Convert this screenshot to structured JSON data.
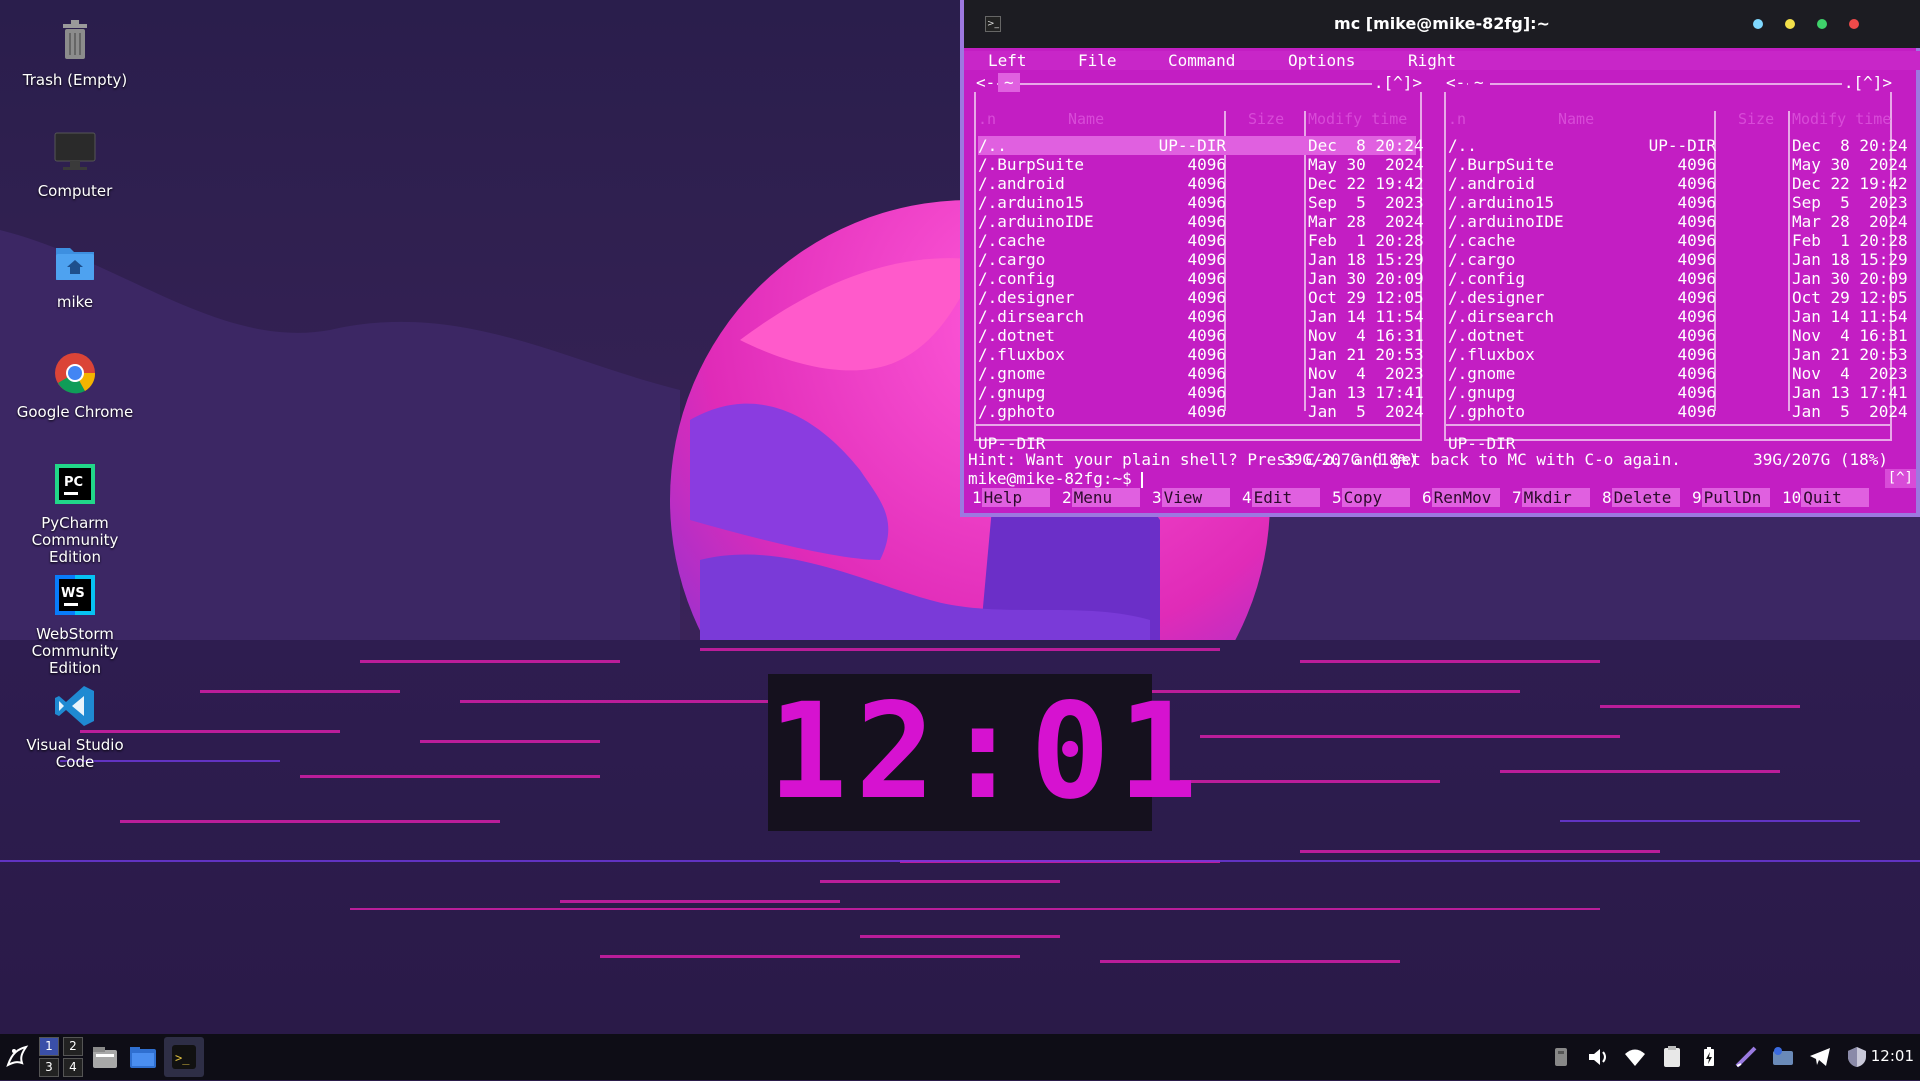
{
  "desktop": {
    "icons": [
      {
        "label": "Trash (Empty)"
      },
      {
        "label": "Computer"
      },
      {
        "label": "mike"
      },
      {
        "label": "Google Chrome"
      },
      {
        "label": "PyCharm Community Edition",
        "badge": "PC"
      },
      {
        "label": "WebStorm Community Edition",
        "badge": "WS"
      },
      {
        "label": "Visual Studio Code"
      }
    ],
    "clock": "12:01"
  },
  "window": {
    "title": "mc [mike@mike-82fg]:~",
    "menu": [
      "Left",
      "File",
      "Command",
      "Options",
      "Right"
    ],
    "left_panel": {
      "path": "~",
      "header_right": ".[^]>",
      "header_left": "<-"
    },
    "right_panel": {
      "path": "~",
      "header_right": ".[^]>",
      "header_left": "<-"
    },
    "columns": {
      "name": "Name",
      "size": "Size",
      "modify": "Modify time",
      "sort": ".n"
    },
    "rows": [
      {
        "name": "/..",
        "size": "UP--DIR",
        "time": "Dec  8 20:24"
      },
      {
        "name": "/.BurpSuite",
        "size": "4096",
        "time": "May 30  2024"
      },
      {
        "name": "/.android",
        "size": "4096",
        "time": "Dec 22 19:42"
      },
      {
        "name": "/.arduino15",
        "size": "4096",
        "time": "Sep  5  2023"
      },
      {
        "name": "/.arduinoIDE",
        "size": "4096",
        "time": "Mar 28  2024"
      },
      {
        "name": "/.cache",
        "size": "4096",
        "time": "Feb  1 20:28"
      },
      {
        "name": "/.cargo",
        "size": "4096",
        "time": "Jan 18 15:29"
      },
      {
        "name": "/.config",
        "size": "4096",
        "time": "Jan 30 20:09"
      },
      {
        "name": "/.designer",
        "size": "4096",
        "time": "Oct 29 12:05"
      },
      {
        "name": "/.dirsearch",
        "size": "4096",
        "time": "Jan 14 11:54"
      },
      {
        "name": "/.dotnet",
        "size": "4096",
        "time": "Nov  4 16:31"
      },
      {
        "name": "/.fluxbox",
        "size": "4096",
        "time": "Jan 21 20:53"
      },
      {
        "name": "/.gnome",
        "size": "4096",
        "time": "Nov  4  2023"
      },
      {
        "name": "/.gnupg",
        "size": "4096",
        "time": "Jan 13 17:41"
      },
      {
        "name": "/.gphoto",
        "size": "4096",
        "time": "Jan  5  2024"
      }
    ],
    "status": "UP--DIR",
    "disk": "39G/207G (18%)",
    "hint": "Hint: Want your plain shell? Press C-o, and get back to MC with C-o again.",
    "prompt": "mike@mike-82fg:~$ ",
    "scroll_hint": "[^]",
    "fkeys": [
      {
        "num": "1",
        "label": "Help"
      },
      {
        "num": "2",
        "label": "Menu"
      },
      {
        "num": "3",
        "label": "View"
      },
      {
        "num": "4",
        "label": "Edit"
      },
      {
        "num": "5",
        "label": "Copy"
      },
      {
        "num": "6",
        "label": "RenMov"
      },
      {
        "num": "7",
        "label": "Mkdir"
      },
      {
        "num": "8",
        "label": "Delete"
      },
      {
        "num": "9",
        "label": "PullDn"
      },
      {
        "num": "10",
        "label": "Quit"
      }
    ]
  },
  "taskbar": {
    "workspaces": [
      "1",
      "2",
      "3",
      "4"
    ],
    "clock": "12:01"
  },
  "colors": {
    "accent": "#c31ec3",
    "frame": "#9d78e0"
  }
}
